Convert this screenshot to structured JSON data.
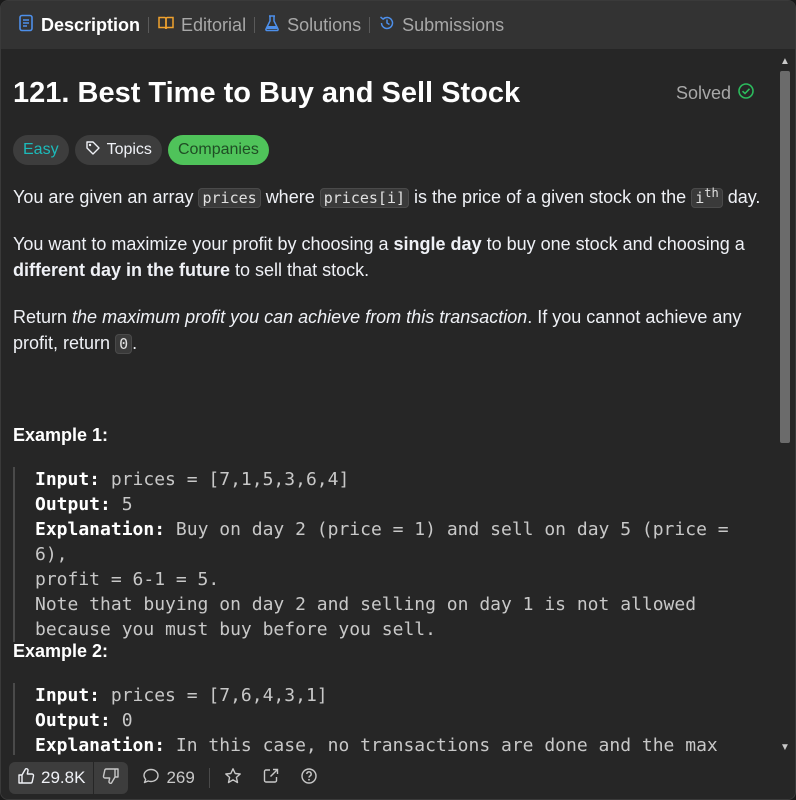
{
  "tabs": [
    {
      "label": "Description",
      "icon": "description-icon"
    },
    {
      "label": "Editorial",
      "icon": "book-icon"
    },
    {
      "label": "Solutions",
      "icon": "flask-icon"
    },
    {
      "label": "Submissions",
      "icon": "history-icon"
    }
  ],
  "problem": {
    "title": "121. Best Time to Buy and Sell Stock",
    "solved_label": "Solved",
    "difficulty": "Easy",
    "topics_label": "Topics",
    "companies_label": "Companies"
  },
  "description": {
    "p1_a": "You are given an array",
    "p1_code1": "prices",
    "p1_b": "where",
    "p1_code2": "prices[i]",
    "p1_c": "is the price of a given stock on the",
    "p1_code3": "i",
    "p1_sup": "th",
    "p1_d": "day.",
    "p2_a": "You want to maximize your profit by choosing a",
    "p2_bold1": "single day",
    "p2_b": "to buy one stock and choosing a",
    "p2_bold2": "different day in the future",
    "p2_c": "to sell that stock.",
    "p3_a": "Return",
    "p3_italic": "the maximum profit you can achieve from this transaction",
    "p3_b": ". If you cannot achieve any profit, return",
    "p3_code": "0",
    "p3_c": "."
  },
  "examples": [
    {
      "title": "Example 1:",
      "input_label": "Input:",
      "input": "prices = [7,1,5,3,6,4]",
      "output_label": "Output:",
      "output": "5",
      "explanation_label": "Explanation:",
      "explanation_line1": "Buy on day 2 (price = 1) and sell on day 5 (price = 6),",
      "explanation_line2": "profit = 6-1 = 5.",
      "explanation_line3": "Note that buying on day 2 and selling on day 1 is not allowed",
      "explanation_line4": "because you must buy before you sell."
    },
    {
      "title": "Example 2:",
      "input_label": "Input:",
      "input": "prices = [7,6,4,3,1]",
      "output_label": "Output:",
      "output": "0",
      "explanation_label": "Explanation:",
      "explanation_line1": "In this case, no transactions are done and the max"
    }
  ],
  "bottom": {
    "likes": "29.8K",
    "comments": "269"
  },
  "colors": {
    "accent_easy": "#1cbaba",
    "companies_bg": "#4fc35a",
    "solved_check": "#2cbb5d",
    "tab_icon_blue": "#4d8fea"
  }
}
